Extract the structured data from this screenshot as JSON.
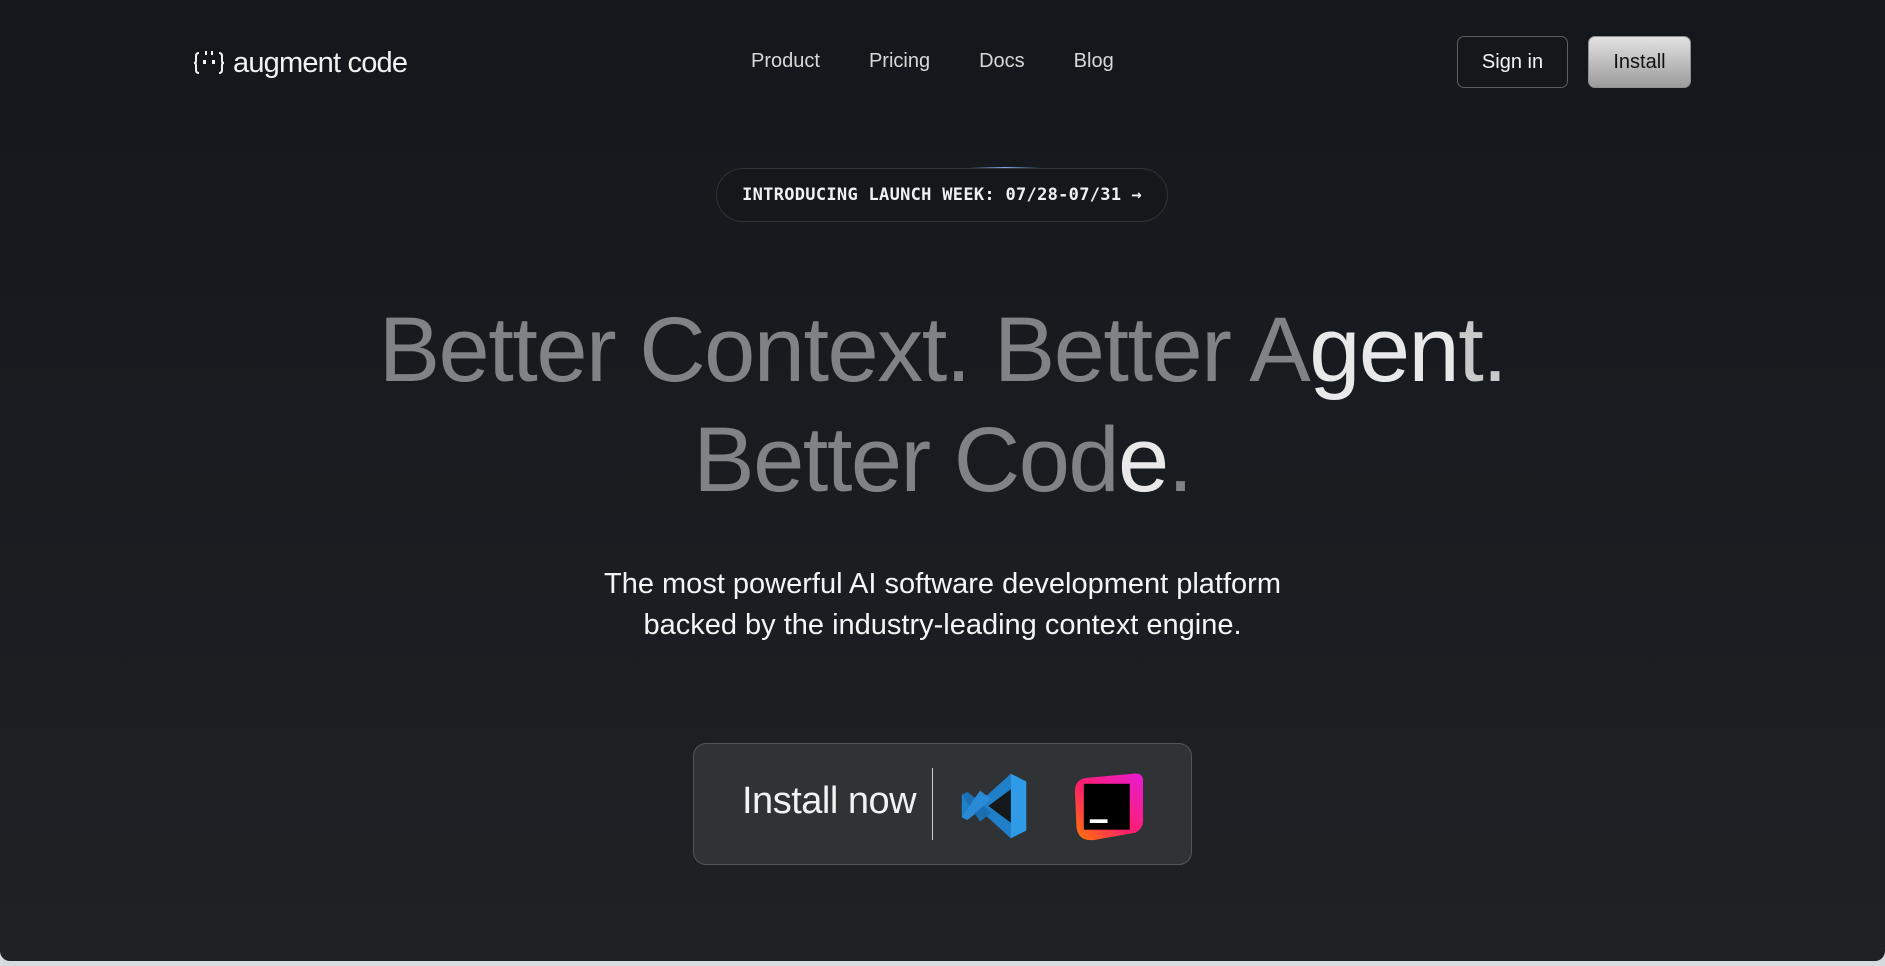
{
  "brand": {
    "name": "augment code"
  },
  "nav": {
    "items": [
      {
        "label": "Product"
      },
      {
        "label": "Pricing"
      },
      {
        "label": "Docs"
      },
      {
        "label": "Blog"
      }
    ]
  },
  "header": {
    "signin_label": "Sign in",
    "install_label": "Install"
  },
  "announcement": {
    "text": "INTRODUCING LAUNCH WEEK: 07/28-07/31",
    "arrow": "→"
  },
  "hero": {
    "line1_dim": "Better Context. Better A",
    "line1_bright": "gen",
    "line1_end": "t.",
    "line2_dim": "Better Cod",
    "line2_bright": "e",
    "line2_end": "."
  },
  "subtitle": {
    "line1": "The most powerful AI software development platform",
    "line2": "backed by the industry-leading context engine."
  },
  "install": {
    "label": "Install now",
    "icons": [
      "vscode-icon",
      "jetbrains-icon"
    ]
  },
  "colors": {
    "background": "#14181c",
    "accent_button": "#c2c2c2",
    "text": "#f2f2f2"
  }
}
